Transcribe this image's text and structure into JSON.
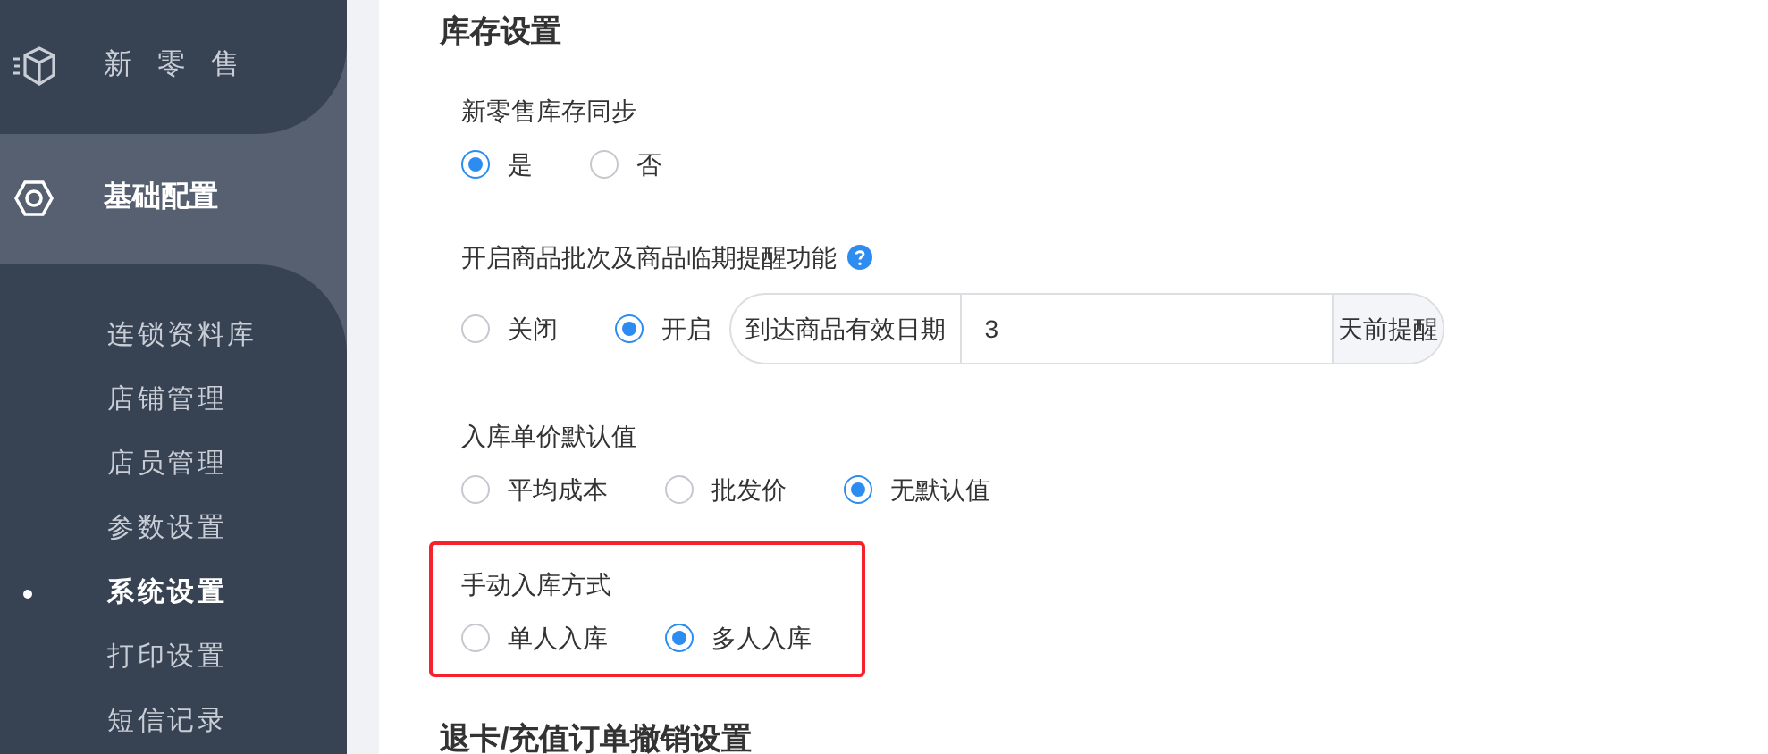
{
  "sidebar": {
    "menu": [
      {
        "label": "新 零 售",
        "selected": false
      },
      {
        "label": "基础配置",
        "selected": true
      }
    ],
    "submenu": [
      {
        "label": "连锁资料库",
        "selected": false
      },
      {
        "label": "店铺管理",
        "selected": false
      },
      {
        "label": "店员管理",
        "selected": false
      },
      {
        "label": "参数设置",
        "selected": false
      },
      {
        "label": "系统设置",
        "selected": true
      },
      {
        "label": "打印设置",
        "selected": false
      },
      {
        "label": "短信记录",
        "selected": false
      }
    ]
  },
  "sections": [
    {
      "title": "库存设置",
      "settings": [
        {
          "label": "新零售库存同步",
          "highlighted": false,
          "options": [
            {
              "label": "是",
              "selected": true
            },
            {
              "label": "否",
              "selected": false
            }
          ]
        },
        {
          "label": "开启商品批次及商品临期提醒功能",
          "help": true,
          "highlighted": false,
          "options": [
            {
              "label": "关闭",
              "selected": false
            },
            {
              "label": "开启",
              "selected": true
            }
          ],
          "input_group": {
            "prefix": "到达商品有效日期",
            "value": "3",
            "suffix": "天前提醒"
          }
        },
        {
          "label": "入库单价默认值",
          "highlighted": false,
          "options": [
            {
              "label": "平均成本",
              "selected": false
            },
            {
              "label": "批发价",
              "selected": false
            },
            {
              "label": "无默认值",
              "selected": true
            }
          ]
        },
        {
          "label": "手动入库方式",
          "highlighted": true,
          "options": [
            {
              "label": "单人入库",
              "selected": false
            },
            {
              "label": "多人入库",
              "selected": true
            }
          ]
        }
      ]
    },
    {
      "title": "退卡/充值订单撤销设置"
    }
  ]
}
